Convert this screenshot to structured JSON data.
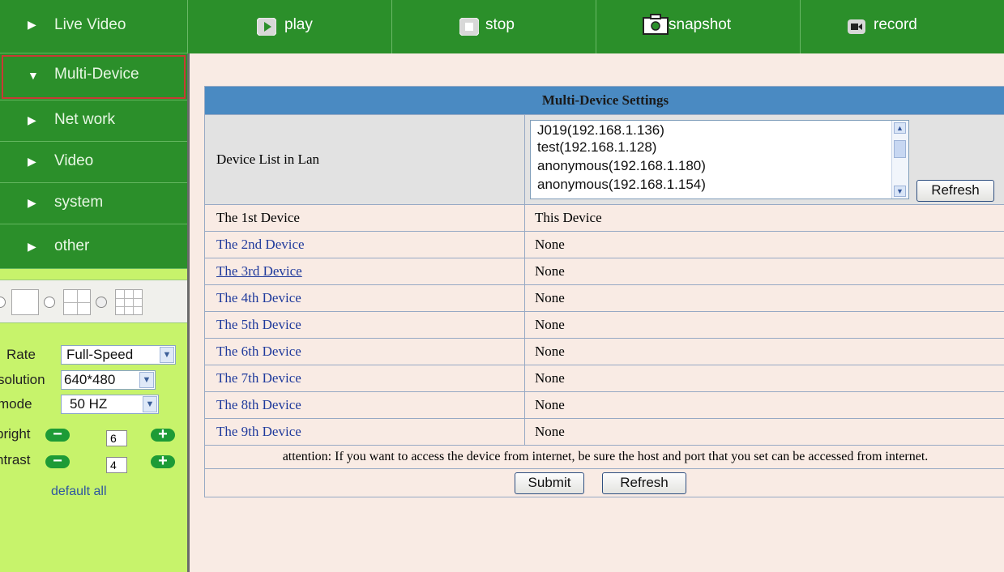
{
  "sidebar": {
    "items": [
      {
        "label": "Live Video",
        "arrow": "▶"
      },
      {
        "label": "Multi-Device",
        "arrow": "▼"
      },
      {
        "label": "Net work",
        "arrow": "▶"
      },
      {
        "label": "Video",
        "arrow": "▶"
      },
      {
        "label": "system",
        "arrow": "▶"
      },
      {
        "label": "other",
        "arrow": "▶"
      }
    ],
    "controls": {
      "rate_label": "Rate",
      "rate_value": "Full-Speed",
      "resolution_label": "solution",
      "resolution_value": "640*480",
      "mode_label": "mode",
      "mode_value": "50 HZ",
      "bright_label": "bright",
      "bright_value": "6",
      "contrast_label": "ntrast",
      "contrast_value": "4",
      "minus": "−",
      "plus": "+",
      "default_all": "default all"
    }
  },
  "toolbar": {
    "play": "play",
    "stop": "stop",
    "snapshot": "snapshot",
    "record": "record"
  },
  "settings": {
    "title": "Multi-Device Settings",
    "lan_label": "Device List in Lan",
    "lan_devices": [
      "J019(192.168.1.136)",
      "test(192.168.1.128)",
      "anonymous(192.168.1.180)",
      "anonymous(192.168.1.154)"
    ],
    "refresh": "Refresh",
    "devices": [
      {
        "name": "The 1st Device",
        "value": "This Device"
      },
      {
        "name": "The 2nd Device",
        "value": "None"
      },
      {
        "name": "The 3rd Device",
        "value": "None"
      },
      {
        "name": "The 4th Device",
        "value": "None"
      },
      {
        "name": "The 5th Device",
        "value": "None"
      },
      {
        "name": "The 6th Device",
        "value": "None"
      },
      {
        "name": "The 7th Device",
        "value": "None"
      },
      {
        "name": "The 8th Device",
        "value": "None"
      },
      {
        "name": "The 9th Device",
        "value": "None"
      }
    ],
    "attention": "attention: If you want to access the device from internet, be sure the host and port that you set can be accessed from internet.",
    "submit": "Submit",
    "refresh_bottom": "Refresh"
  },
  "colors": {
    "nav_green": "#2b8f2a",
    "sidebar_lime": "#c7f36b",
    "header_blue": "#4a8ac2",
    "main_bg": "#f9ebe4",
    "active_outline": "#c83a34"
  }
}
